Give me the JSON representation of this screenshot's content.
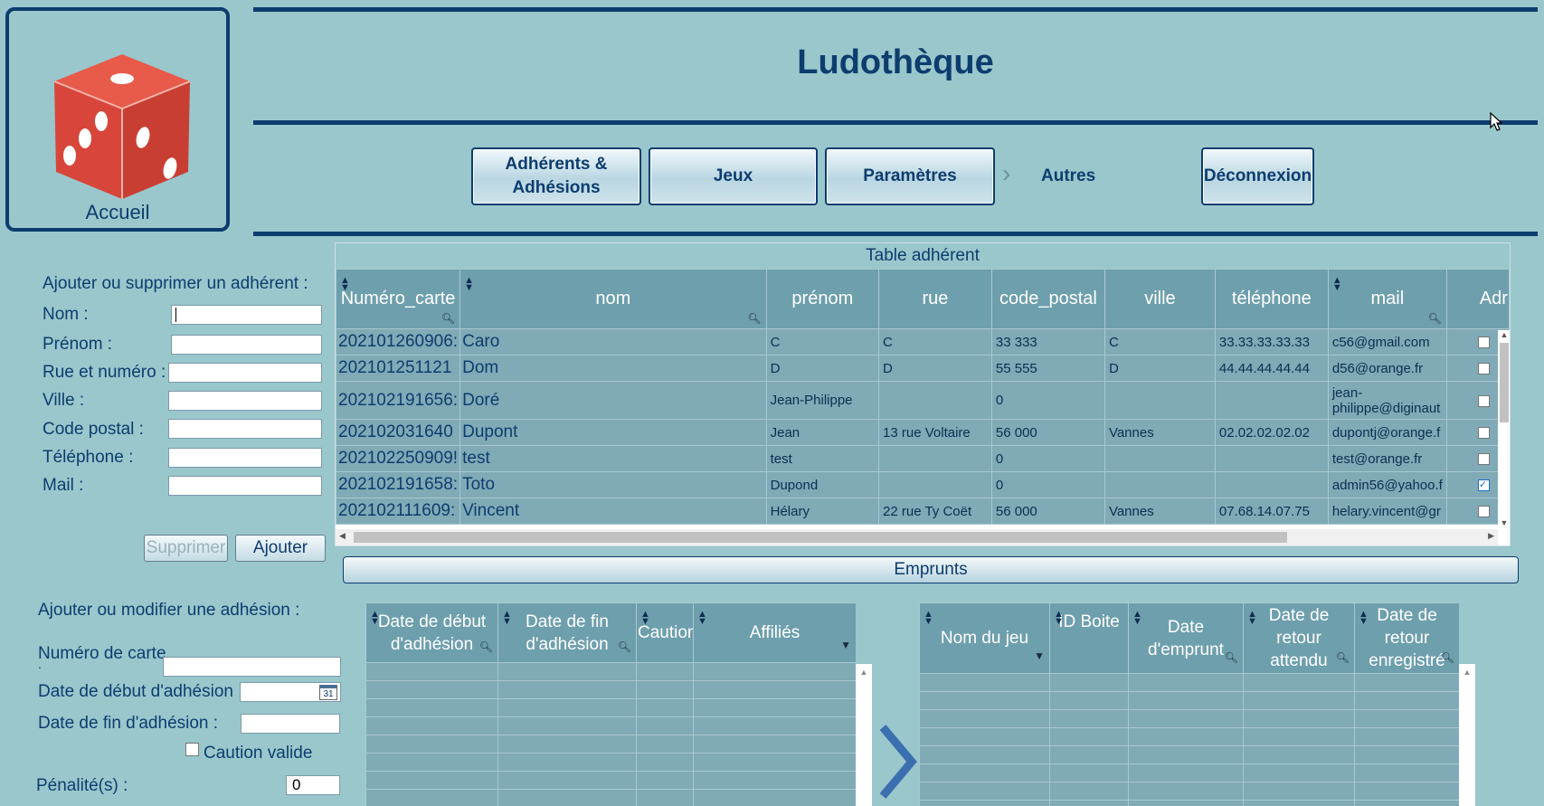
{
  "header": {
    "logo_caption": "Accueil",
    "title": "Ludothèque"
  },
  "nav": {
    "adherents_line1": "Adhérents &",
    "adherents_line2": "Adhésions",
    "jeux": "Jeux",
    "parametres": "Paramètres",
    "autres": "Autres",
    "deconnexion": "Déconnexion"
  },
  "adherent_form": {
    "heading": "Ajouter ou supprimer un adhérent :",
    "nom": "Nom :",
    "prenom": "Prénom :",
    "rue": "Rue et numéro :",
    "ville": "Ville :",
    "code_postal": "Code postal :",
    "telephone": "Téléphone :",
    "mail": "Mail :",
    "supprimer": "Supprimer",
    "ajouter": "Ajouter"
  },
  "adherent_table": {
    "caption": "Table adhérent",
    "columns": [
      "Numéro_carte",
      "nom",
      "prénom",
      "rue",
      "code_postal",
      "ville",
      "téléphone",
      "mail",
      "Adr"
    ],
    "rows": [
      {
        "carte": "202101260906:",
        "nom": "Caro",
        "prenom": "C",
        "rue": "C",
        "cp": "33 333",
        "ville": "C",
        "tel": "33.33.33.33.33",
        "mail": "c56@gmail.com",
        "checked": false
      },
      {
        "carte": "202101251121",
        "nom": "Dom",
        "prenom": "D",
        "rue": "D",
        "cp": "55 555",
        "ville": "D",
        "tel": "44.44.44.44.44",
        "mail": "d56@orange.fr",
        "checked": false
      },
      {
        "carte": "202102191656:",
        "nom": "Doré",
        "prenom": "Jean-Philippe",
        "rue": "",
        "cp": "0",
        "ville": "",
        "tel": "",
        "mail": "jean-philippe@diginaut",
        "checked": false
      },
      {
        "carte": "202102031640",
        "nom": "Dupont",
        "prenom": "Jean",
        "rue": "13 rue Voltaire",
        "cp": "56 000",
        "ville": "Vannes",
        "tel": "02.02.02.02.02",
        "mail": "dupontj@orange.f",
        "checked": false
      },
      {
        "carte": "202102250909!",
        "nom": "test",
        "prenom": "test",
        "rue": "",
        "cp": "0",
        "ville": "",
        "tel": "",
        "mail": "test@orange.fr",
        "checked": false
      },
      {
        "carte": "202102191658:",
        "nom": "Toto",
        "prenom": "Dupond",
        "rue": "",
        "cp": "0",
        "ville": "",
        "tel": "",
        "mail": "admin56@yahoo.f",
        "checked": true
      },
      {
        "carte": "202102111609:",
        "nom": "Vincent",
        "prenom": "Hélary",
        "rue": "22 rue Ty Coët",
        "cp": "56 000",
        "ville": "Vannes",
        "tel": "07.68.14.07.75",
        "mail": "helary.vincent@gr",
        "checked": false
      }
    ]
  },
  "emprunts": {
    "label": "Emprunts"
  },
  "adhesion_form": {
    "heading": "Ajouter ou modifier une adhésion :",
    "numero_carte": "Numéro de carte",
    "numero_carte_dot": ".",
    "date_debut": "Date de début d'adhésion :",
    "date_fin": "Date de fin d'adhésion :",
    "caution_valide": "Caution valide",
    "penalites": "Pénalité(s) :",
    "penalites_value": "0",
    "calendar_day": "31"
  },
  "adhesion_table": {
    "col_debut_1": "Date de début",
    "col_debut_2": "d'adhésion",
    "col_fin_1": "Date de fin",
    "col_fin_2": "d'adhésion",
    "col_caution": "Caution",
    "col_affilies": "Affiliés"
  },
  "emprunt_table": {
    "col_jeu": "Nom du jeu",
    "col_boite": "ID Boite",
    "col_date": "Date d'emprunt",
    "col_retour_att_1": "Date de retour",
    "col_retour_att_2": "attendu",
    "col_retour_enr_1": "Date de retour",
    "col_retour_enr_2": "enregistré"
  },
  "colors": {
    "background": "#99c7cc",
    "primary": "#0d3d6e",
    "header_cell": "#6e9fad",
    "row_cell": "#7faab6",
    "dice": "#e04a3c"
  }
}
